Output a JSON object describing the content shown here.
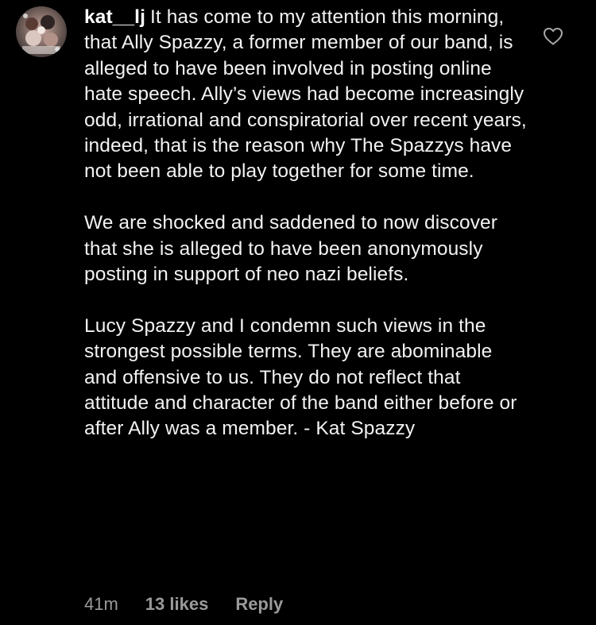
{
  "comment": {
    "username": "kat__lj",
    "paragraphs": [
      "It has come to my attention this morning, that Ally Spazzy, a former member of our band, is alleged to have been involved in posting online hate speech. Ally’s views had become increasingly odd, irrational and conspiratorial over recent years, indeed, that is the reason why The Spazzys have not been able to play together for some time.",
      "We are shocked and saddened to now discover that she is alleged to have been anonymously posting in support of neo nazi beliefs.",
      "Lucy Spazzy and I condemn such views in the strongest possible terms. They are abominable and offensive to us. They do not reflect that attitude and character of the band either before or after Ally was a member. - Kat Spazzy"
    ],
    "timestamp": "41m",
    "likes": "13 likes",
    "reply_label": "Reply",
    "like_icon": "heart-outline-icon",
    "avatar_icon": "profile-avatar"
  },
  "colors": {
    "background": "#000000",
    "text": "#f2f2f2",
    "meta": "#9a9a9a"
  }
}
